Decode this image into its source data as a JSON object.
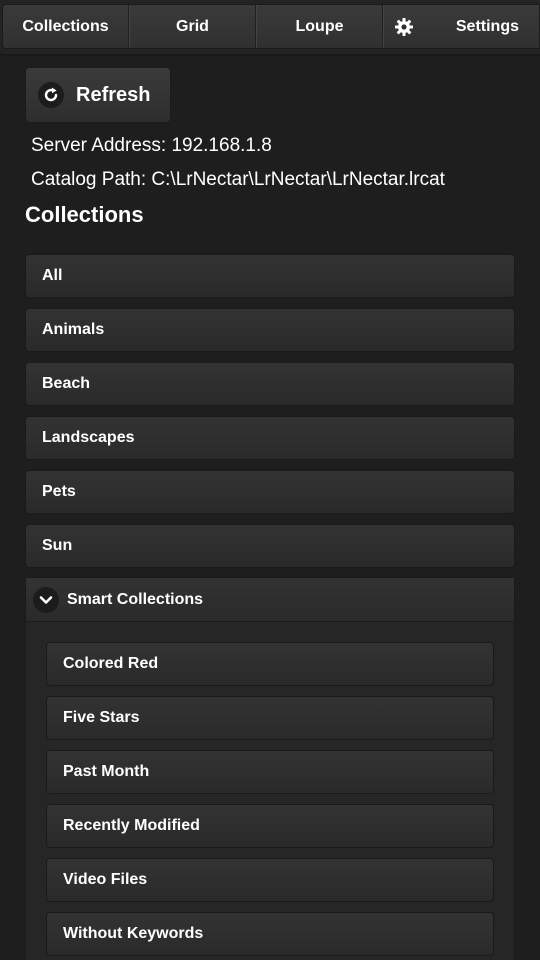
{
  "nav": {
    "collections": "Collections",
    "grid": "Grid",
    "loupe": "Loupe",
    "settings": "Settings",
    "settings_icon": "gear-icon"
  },
  "refresh": {
    "label": "Refresh",
    "icon": "refresh-icon"
  },
  "info": {
    "server": "Server Address: 192.168.1.8",
    "catalog": "Catalog Path: C:\\LrNectar\\LrNectar\\LrNectar.lrcat"
  },
  "section_title": "Collections",
  "collections": [
    "All",
    "Animals",
    "Beach",
    "Landscapes",
    "Pets",
    "Sun"
  ],
  "smart_collections": {
    "label": "Smart Collections",
    "icon": "chevron-down-icon",
    "items": [
      "Colored Red",
      "Five Stars",
      "Past Month",
      "Recently Modified",
      "Video Files",
      "Without Keywords"
    ]
  },
  "colors": {
    "background": "#1e1e1e",
    "button": "#303030",
    "text": "#ffffff"
  }
}
